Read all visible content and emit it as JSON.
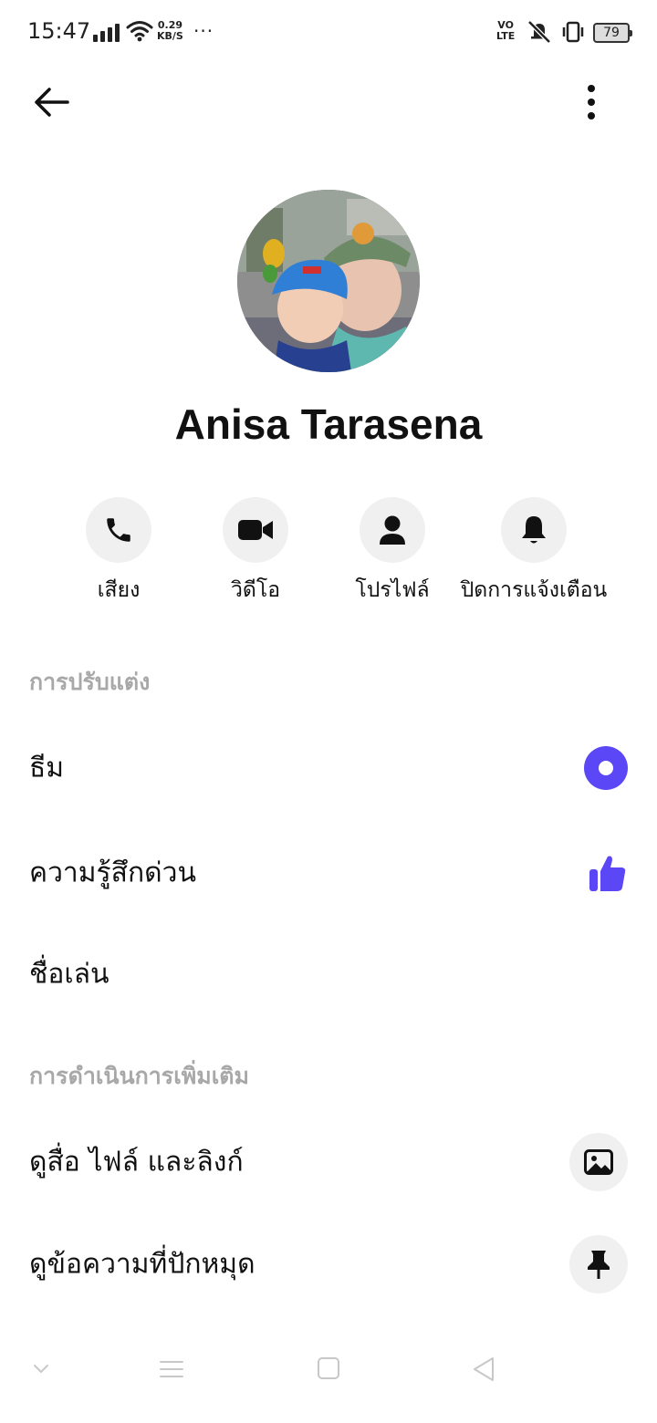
{
  "status_bar": {
    "time": "15:47",
    "speed_value": "0.29",
    "speed_unit": "KB/S",
    "dots": "···",
    "volte_top": "VO",
    "volte_bottom": "LTE",
    "battery": "79"
  },
  "header": {
    "back_icon": "arrow-left-icon",
    "more_icon": "more-vertical-icon"
  },
  "profile": {
    "name": "Anisa Tarasena"
  },
  "actions": [
    {
      "label": "เสียง",
      "icon": "phone-icon"
    },
    {
      "label": "วิดีโอ",
      "icon": "video-icon"
    },
    {
      "label": "โปรไฟล์",
      "icon": "person-icon"
    },
    {
      "label": "ปิดการแจ้งเตือน",
      "icon": "bell-icon"
    }
  ],
  "customization": {
    "title": "การปรับแต่ง",
    "theme_label": "ธีม",
    "quick_reaction_label": "ความรู้สึกด่วน",
    "nickname_label": "ชื่อเล่น"
  },
  "more_actions": {
    "title": "การดำเนินการเพิ่มเติม",
    "media_label": "ดูสื่อ ไฟล์ และลิงก์",
    "pinned_label": "ดูข้อความที่ปักหมุด"
  },
  "colors": {
    "accent": "#5b47f5",
    "section_title": "#a8a8a8",
    "button_bg": "#f0f0f0"
  }
}
